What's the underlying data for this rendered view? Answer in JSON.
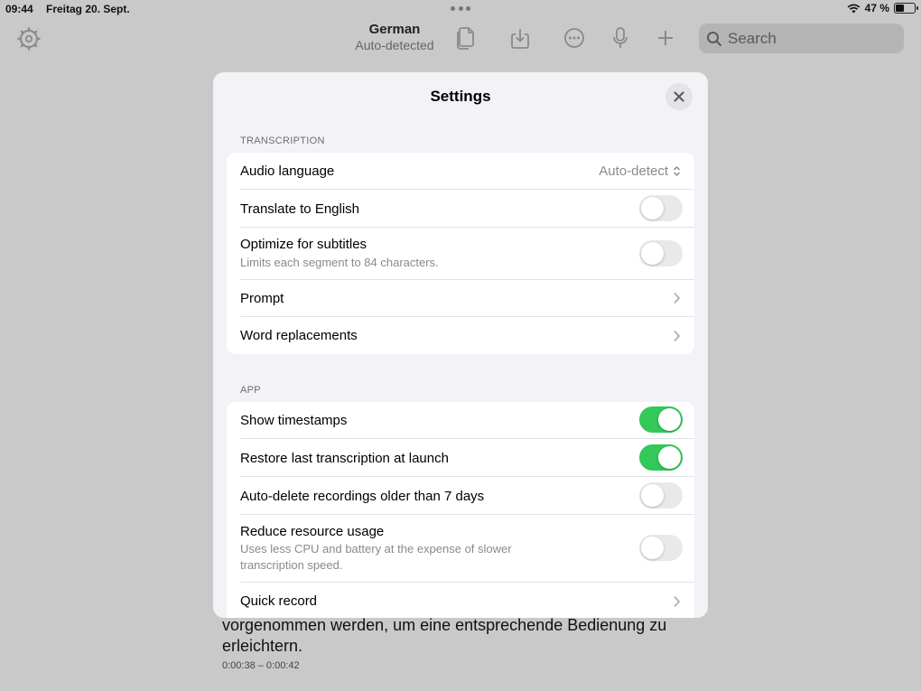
{
  "status": {
    "time": "09:44",
    "date": "Freitag 20. Sept.",
    "battery_text": "47 %",
    "battery_level": 0.47
  },
  "toolbar": {
    "title": "German",
    "subtitle": "Auto-detected",
    "search_placeholder": "Search"
  },
  "transcript": {
    "text_line1": "vorgenommen werden, um eine entsprechende Bedienung zu",
    "text_line2": "erleichtern.",
    "time_range": "0:00:38 – 0:00:42"
  },
  "settings": {
    "title": "Settings",
    "transcription_header": "TRANSCRIPTION",
    "audio_language_label": "Audio language",
    "audio_language_value": "Auto-detect",
    "translate_label": "Translate to English",
    "translate_on": false,
    "subtitles_label": "Optimize for subtitles",
    "subtitles_sub": "Limits each segment to 84 characters.",
    "subtitles_on": false,
    "prompt_label": "Prompt",
    "word_replacements_label": "Word replacements",
    "app_header": "APP",
    "timestamps_label": "Show timestamps",
    "timestamps_on": true,
    "restore_label": "Restore last transcription at launch",
    "restore_on": true,
    "autodelete_label": "Auto-delete recordings older than 7 days",
    "autodelete_on": false,
    "reduce_label": "Reduce resource usage",
    "reduce_sub": "Uses less CPU and battery at the expense of slower transcription speed.",
    "reduce_on": false,
    "quick_record_label": "Quick record"
  },
  "colors": {
    "toggle_on": "#34c759",
    "toggle_off": "#e9e9ea",
    "modal_bg": "#f2f2f7",
    "dim_bg": "#c9c9c9"
  }
}
